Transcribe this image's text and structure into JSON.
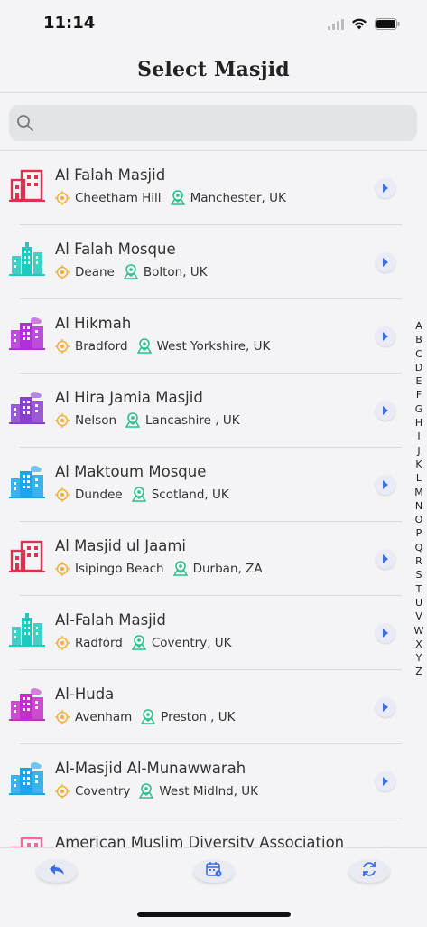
{
  "status": {
    "time": "11:14"
  },
  "header": {
    "title": "Select Masjid"
  },
  "search": {
    "placeholder": "",
    "value": ""
  },
  "masjids": [
    {
      "name": "Al Falah Masjid",
      "area": "Cheetham Hill",
      "city": "Manchester, UK",
      "icon": "building-icon",
      "color": "#e0304e"
    },
    {
      "name": "Al Falah Mosque",
      "area": "Deane",
      "city": "Bolton, UK",
      "icon": "tower-icon",
      "color": "#1ec9c0"
    },
    {
      "name": "Al Hikmah",
      "area": "Bradford",
      "city": "West Yorkshire, UK",
      "icon": "city-icon",
      "color": "#b02fd6"
    },
    {
      "name": "Al Hira Jamia Masjid",
      "area": "Nelson",
      "city": "Lancashire , UK",
      "icon": "city-icon",
      "color": "#8a3fcf"
    },
    {
      "name": "Al Maktoum Mosque",
      "area": "Dundee",
      "city": "Scotland, UK",
      "icon": "city-icon",
      "color": "#1aa6ea"
    },
    {
      "name": "Al Masjid ul Jaami",
      "area": "Isipingo Beach",
      "city": "Durban, ZA",
      "icon": "building-icon",
      "color": "#e0304e"
    },
    {
      "name": "Al-Falah Masjid",
      "area": "Radford",
      "city": "Coventry, UK",
      "icon": "tower-icon",
      "color": "#1ec9c0"
    },
    {
      "name": "Al-Huda",
      "area": "Avenham",
      "city": "Preston , UK",
      "icon": "city-icon",
      "color": "#c22fc6"
    },
    {
      "name": "Al-Masjid Al-Munawwarah",
      "area": "Coventry",
      "city": "West Midlnd, UK",
      "icon": "city-icon",
      "color": "#1aa6ea"
    },
    {
      "name": "American Muslim Diversity Association",
      "area": "",
      "city": "",
      "icon": "building-icon",
      "color": "#f06aa0"
    }
  ],
  "index_letters": [
    "A",
    "B",
    "C",
    "D",
    "E",
    "F",
    "G",
    "H",
    "I",
    "J",
    "K",
    "L",
    "M",
    "N",
    "O",
    "P",
    "Q",
    "R",
    "S",
    "T",
    "U",
    "V",
    "W",
    "X",
    "Y",
    "Z"
  ],
  "toolbar": [
    {
      "name": "back-icon"
    },
    {
      "name": "calendar-icon"
    },
    {
      "name": "refresh-icon"
    }
  ],
  "colors": {
    "accent": "#3d6fe0",
    "location": "#f2b13c",
    "map": "#2bc08a"
  }
}
